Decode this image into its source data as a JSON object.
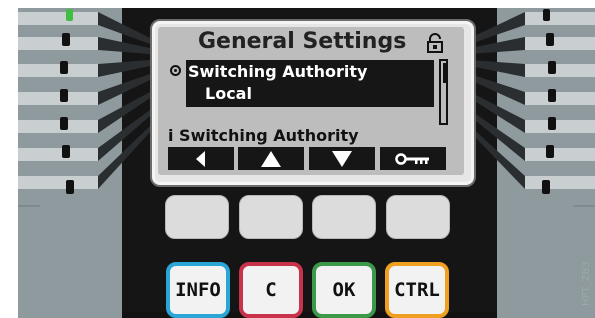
{
  "display": {
    "title": "General Settings",
    "selected_item": "Switching Authority",
    "selected_value": "Local",
    "info_text": "i Switching Authority",
    "softkeys": [
      {
        "icon": "left-arrow-icon"
      },
      {
        "icon": "up-arrow-icon"
      },
      {
        "icon": "down-arrow-icon"
      },
      {
        "icon": "key-icon"
      }
    ],
    "lock_icon": "unlocked-padlock-icon"
  },
  "keypad": {
    "function_keys": [
      {
        "label": "INFO",
        "color": "#2aa6d6"
      },
      {
        "label": "C",
        "color": "#c8324b"
      },
      {
        "label": "OK",
        "color": "#3a9a4a"
      },
      {
        "label": "CTRL",
        "color": "#f0a020"
      }
    ],
    "blank_keys": 4
  },
  "watermark": "HPT_ZB3",
  "colors": {
    "device_body": "#151515",
    "side_panel": "#8e9a9d",
    "lcd_background": "#bdbdbd",
    "led_green": "#3fbe3f"
  }
}
